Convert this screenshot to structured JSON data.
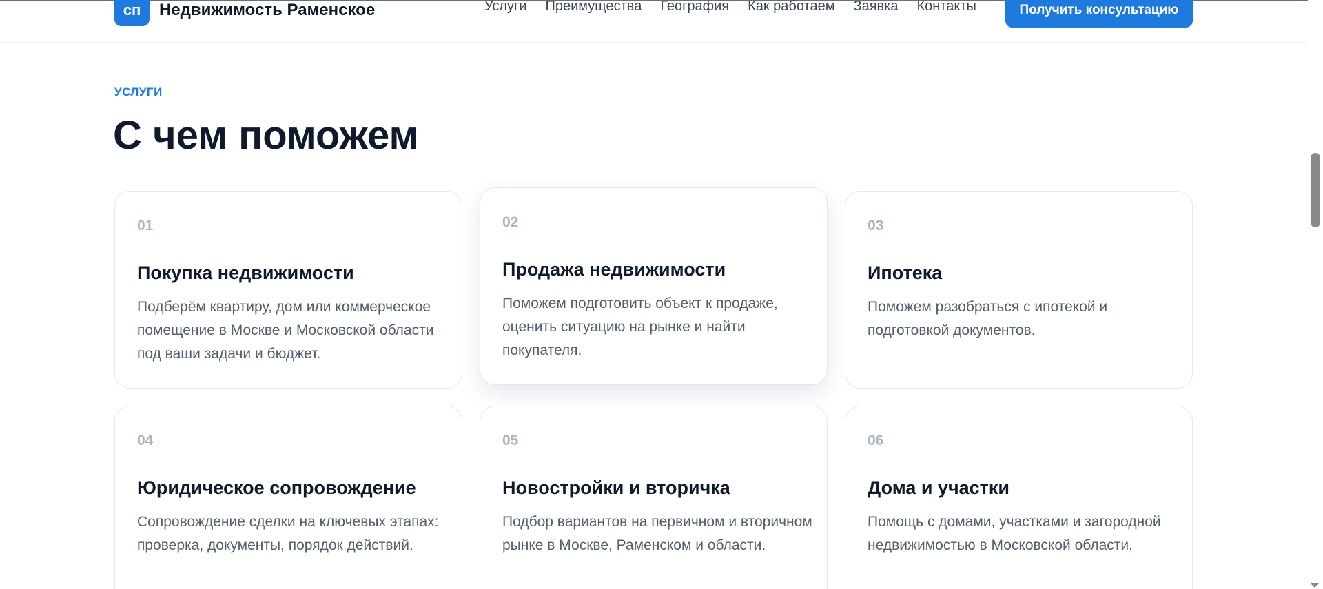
{
  "header": {
    "logo_mark": "сп",
    "logo_text": "Недвижимость Раменское",
    "nav": [
      "Услуги",
      "Преимущества",
      "География",
      "Как работаем",
      "Заявка",
      "Контакты"
    ],
    "cta_label": "Получить консультацию"
  },
  "section": {
    "eyebrow": "УСЛУГИ",
    "title": "С чем поможем"
  },
  "cards": [
    {
      "num": "01",
      "title": "Покупка недвижимости",
      "desc": "Подберём квартиру, дом или коммерческое помещение в Москве и Московской области под ваши задачи и бюджет."
    },
    {
      "num": "02",
      "title": "Продажа недвижимости",
      "desc": "Поможем подготовить объект к продаже, оценить ситуацию на рынке и найти покупателя."
    },
    {
      "num": "03",
      "title": "Ипотека",
      "desc": "Поможем разобраться с ипотекой и подготовкой документов."
    },
    {
      "num": "04",
      "title": "Юридическое сопровождение",
      "desc": "Сопровождение сделки на ключевых этапах: проверка, документы, порядок действий."
    },
    {
      "num": "05",
      "title": "Новостройки и вторичка",
      "desc": "Подбор вариантов на первичном и вторичном рынке в Москве, Раменском и области."
    },
    {
      "num": "06",
      "title": "Дома и участки",
      "desc": "Помощь с домами, участками и загородной недвижимостью в Московской области."
    }
  ],
  "colors": {
    "accent": "#1f7ae0",
    "heading": "#0f1b2d",
    "muted_number": "#a9b5c6"
  }
}
